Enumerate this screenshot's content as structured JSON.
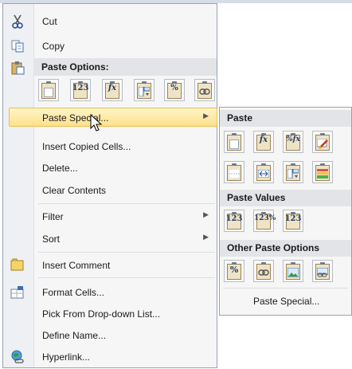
{
  "menu": {
    "cut": "Cut",
    "copy": "Copy",
    "paste_options_header": "Paste Options:",
    "paste_options_tiles": [
      "clipboard-paste",
      "123",
      "fx",
      "transpose",
      "%",
      "link"
    ],
    "paste_special": "Paste Special...",
    "insert_copied_cells": "Insert Copied Cells...",
    "delete": "Delete...",
    "clear_contents": "Clear Contents",
    "filter": "Filter",
    "sort": "Sort",
    "insert_comment": "Insert Comment",
    "format_cells": "Format Cells...",
    "pick_from_list": "Pick From Drop-down List...",
    "define_name": "Define Name...",
    "hyperlink": "Hyperlink..."
  },
  "submenu": {
    "paste_header": "Paste",
    "paste_values_header": "Paste Values",
    "other_paste_header": "Other Paste Options",
    "paste_special": "Paste Special...",
    "tile_glyphs": {
      "fx": "fx",
      "percent_fx": "%fx",
      "values": "123",
      "values_percent": "123%"
    }
  }
}
